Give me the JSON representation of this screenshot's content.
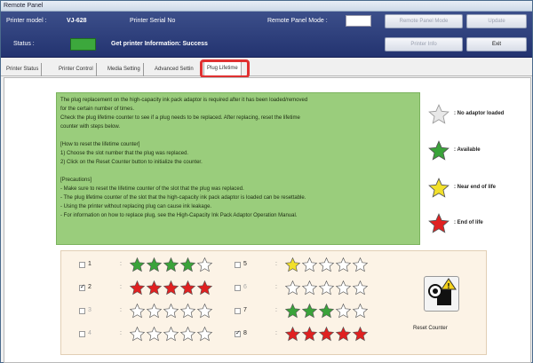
{
  "window": {
    "title": "Remote Panel"
  },
  "header": {
    "printer_model_label": "Printer model :",
    "printer_model_value": "VJ-628",
    "serial_label": "Printer Serial No",
    "remote_mode_label": "Remote Panel Mode :",
    "remote_panel_mode_button": "Remote Panel Mode",
    "update_button": "Update",
    "status_label": "Status :",
    "status_text": "Get printer Information: Success",
    "printer_info_button": "Printer Info",
    "exit_button": "Exit",
    "status_color": "#3ca83c"
  },
  "tabs": [
    "Printer Status",
    "Printer Control",
    "Media Setting",
    "Advanced Settin",
    "Plug Lifetime"
  ],
  "selected_tab": "Plug Lifetime",
  "info": {
    "lines": [
      "The plug replacement on the high-capacity ink pack adaptor is required after it has been loaded/removed",
      "for the certain number of times.",
      "Check the plug lifetime counter to see if a plug needs to be replaced. After replacing, reset the lifetime",
      "counter with steps below."
    ],
    "howto_title": "[How to reset the lifetime counter]",
    "howto": [
      "1) Choose the slot number that the plug was replaced.",
      "2) Click on the Reset Counter button to initialize the counter."
    ],
    "precautions_title": "[Precautions]",
    "precautions": [
      "- Make sure to reset the lifetime counter of the slot that the plug was replaced.",
      "- The plug lifetime counter of the slot that the high-capacity ink pack adaptor is loaded can be resettable.",
      "- Using the printer without replacing plug can cause ink leakage.",
      "- For information on how to replace plug, see the High-Capacity Ink Pack Adaptor Operation Manual."
    ]
  },
  "legend": [
    {
      "label": ": No adaptor loaded",
      "color": "#e8e8e8"
    },
    {
      "label": ": Available",
      "color": "#3aa33a"
    },
    {
      "label": ": Near end of life",
      "color": "#f2e02a"
    },
    {
      "label": ": End of life",
      "color": "#e02020"
    }
  ],
  "slots": [
    {
      "number": "1",
      "checked": false,
      "enabled": true,
      "filled": 4,
      "color": "#3aa33a"
    },
    {
      "number": "2",
      "checked": true,
      "enabled": true,
      "filled": 5,
      "color": "#e02020"
    },
    {
      "number": "3",
      "checked": false,
      "enabled": false,
      "filled": 0,
      "color": "#cccccc"
    },
    {
      "number": "4",
      "checked": false,
      "enabled": false,
      "filled": 0,
      "color": "#cccccc"
    },
    {
      "number": "5",
      "checked": false,
      "enabled": true,
      "filled": 1,
      "color": "#f2e02a"
    },
    {
      "number": "6",
      "checked": false,
      "enabled": false,
      "filled": 0,
      "color": "#cccccc"
    },
    {
      "number": "7",
      "checked": false,
      "enabled": true,
      "filled": 3,
      "color": "#3aa33a"
    },
    {
      "number": "8",
      "checked": true,
      "enabled": true,
      "filled": 5,
      "color": "#e02020"
    }
  ],
  "reset_button": "Reset Counter"
}
